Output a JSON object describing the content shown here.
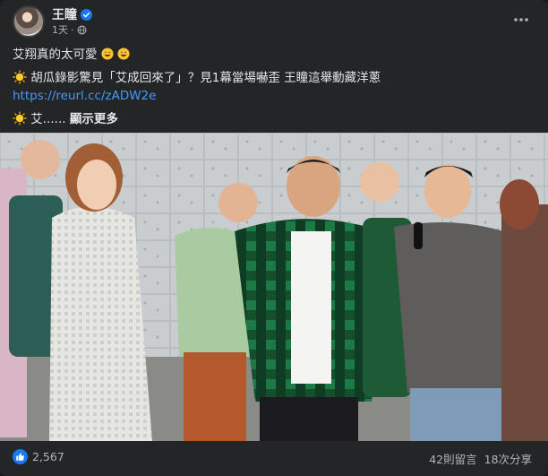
{
  "post": {
    "author": "王瞳",
    "time": "1天",
    "time_separator": "·",
    "lines": {
      "line1": "艾翔真的太可愛",
      "headline": "胡瓜錄影驚見「艾成回來了」？見1幕當場嚇歪 王瞳這舉動藏洋蔥",
      "link": "https://reurl.cc/zADW2e",
      "line3": "艾......",
      "see_more": "顯示更多"
    },
    "icons": {
      "verified": "verified-badge-icon",
      "globe": "globe-icon",
      "more": "more-options-icon",
      "grin": "grinning-emoji-icon",
      "sun": "sun-emoji-icon",
      "like": "like-reaction-icon"
    }
  },
  "footer": {
    "reactions_count": "2,567",
    "comments": "42則留言",
    "shares": "18次分享"
  },
  "colors": {
    "background": "#242526",
    "text": "#e4e6eb",
    "secondary_text": "#b0b3b8",
    "link": "#4599ff",
    "like_blue": "#1877f2"
  }
}
